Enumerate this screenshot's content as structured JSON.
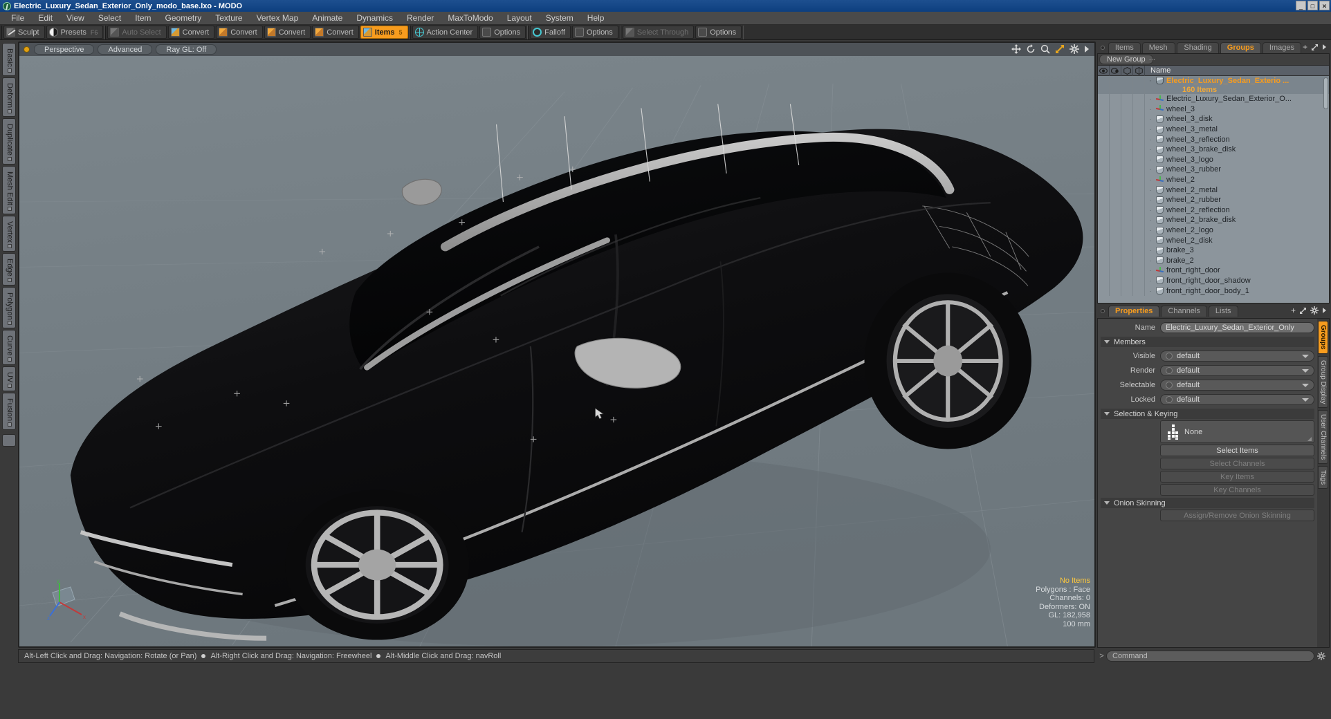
{
  "window": {
    "title": "Electric_Luxury_Sedan_Exterior_Only_modo_base.lxo - MODO",
    "app_icon": "modo-logo-icon",
    "buttons": {
      "minimize": "_",
      "maximize": "□",
      "close": "✕"
    }
  },
  "menubar": {
    "items": [
      "File",
      "Edit",
      "View",
      "Select",
      "Item",
      "Geometry",
      "Texture",
      "Vertex Map",
      "Animate",
      "Dynamics",
      "Render",
      "MaxToModo",
      "Layout",
      "System",
      "Help"
    ]
  },
  "toolbar": {
    "groups": [
      {
        "buttons": [
          {
            "label": "Sculpt",
            "icon": "brush-icon",
            "shortcut": "",
            "state": "normal"
          },
          {
            "label": "Presets",
            "icon": "preset-sphere-icon",
            "shortcut": "F6",
            "state": "normal"
          }
        ]
      },
      {
        "buttons": [
          {
            "label": "Auto Select",
            "icon": "cube-grey-icon",
            "shortcut": "",
            "state": "dim"
          },
          {
            "label": "Convert",
            "icon": "cube-blue-icon",
            "shortcut": "",
            "state": "normal"
          },
          {
            "label": "Convert",
            "icon": "cube-orange-icon",
            "shortcut": "",
            "state": "normal"
          },
          {
            "label": "Convert",
            "icon": "cube-orange-icon",
            "shortcut": "",
            "state": "normal"
          },
          {
            "label": "Convert",
            "icon": "cube-orange-icon",
            "shortcut": "",
            "state": "normal"
          },
          {
            "label": "Items",
            "icon": "cube-blue-icon",
            "shortcut": "5",
            "state": "active"
          }
        ]
      },
      {
        "buttons": [
          {
            "label": "Action Center",
            "icon": "globe-icon",
            "shortcut": "",
            "state": "normal"
          },
          {
            "label": "Options",
            "icon": "square-icon",
            "shortcut": "",
            "state": "normal"
          }
        ]
      },
      {
        "buttons": [
          {
            "label": "Falloff",
            "icon": "ring-icon",
            "shortcut": "",
            "state": "normal"
          },
          {
            "label": "Options",
            "icon": "square-icon",
            "shortcut": "",
            "state": "normal"
          }
        ]
      },
      {
        "buttons": [
          {
            "label": "Select Through",
            "icon": "cube-grey-icon",
            "shortcut": "",
            "state": "dim"
          },
          {
            "label": "Options",
            "icon": "square-icon",
            "shortcut": "",
            "state": "normal"
          }
        ]
      }
    ]
  },
  "left_tabs": {
    "items": [
      "Basic",
      "Deform",
      "Duplicate",
      "Mesh Edit",
      "Vertex",
      "Edge",
      "Polygon",
      "Curve",
      "UV",
      "Fusion"
    ]
  },
  "viewport": {
    "header": {
      "mode": "Perspective",
      "shading": "Advanced",
      "raygl": "Ray GL: Off"
    },
    "icons": [
      "move-icon",
      "rotate-icon",
      "zoom-icon",
      "fit-icon",
      "gear-icon",
      "chevron-right-icon"
    ],
    "stats": {
      "selection": "No Items",
      "polygons": "Polygons : Face",
      "channels": "Channels: 0",
      "deformers": "Deformers: ON",
      "gl": "GL: 182,958",
      "grid": "100 mm"
    },
    "gizmo": {
      "x": "x",
      "y": "y",
      "z": "z"
    }
  },
  "statusbar": {
    "hints": [
      "Alt-Left Click and Drag: Navigation: Rotate (or Pan)",
      "Alt-Right Click and Drag: Navigation: Freewheel",
      "Alt-Middle Click and Drag: navRoll"
    ]
  },
  "right_panel": {
    "tabs": [
      {
        "label": "Items",
        "active": false
      },
      {
        "label": "Mesh ...",
        "active": false
      },
      {
        "label": "Shading",
        "active": false
      },
      {
        "label": "Groups",
        "active": true
      },
      {
        "label": "Images",
        "active": false
      }
    ],
    "tab_add": "+",
    "new_group_button": "New Group",
    "tree_header": {
      "columns": [
        "eye-icon",
        "render-icon",
        "wireframe-icon",
        "ghost-icon"
      ],
      "name": "Name"
    },
    "group": {
      "name": "Electric_Luxury_Sedan_Exterio ...",
      "count": "160 Items"
    },
    "items": [
      {
        "label": "Electric_Luxury_Sedan_Exterior_O...",
        "icon": "locator-icon"
      },
      {
        "label": "wheel_3",
        "icon": "locator-icon"
      },
      {
        "label": "wheel_3_disk",
        "icon": "mesh-icon"
      },
      {
        "label": "wheel_3_metal",
        "icon": "mesh-icon"
      },
      {
        "label": "wheel_3_reflection",
        "icon": "mesh-icon"
      },
      {
        "label": "wheel_3_brake_disk",
        "icon": "mesh-icon"
      },
      {
        "label": "wheel_3_logo",
        "icon": "mesh-icon"
      },
      {
        "label": "wheel_3_rubber",
        "icon": "mesh-icon"
      },
      {
        "label": "wheel_2",
        "icon": "locator-icon"
      },
      {
        "label": "wheel_2_metal",
        "icon": "mesh-icon"
      },
      {
        "label": "wheel_2_rubber",
        "icon": "mesh-icon"
      },
      {
        "label": "wheel_2_reflection",
        "icon": "mesh-icon"
      },
      {
        "label": "wheel_2_brake_disk",
        "icon": "mesh-icon"
      },
      {
        "label": "wheel_2_logo",
        "icon": "mesh-icon"
      },
      {
        "label": "wheel_2_disk",
        "icon": "mesh-icon"
      },
      {
        "label": "brake_3",
        "icon": "mesh-icon"
      },
      {
        "label": "brake_2",
        "icon": "mesh-icon"
      },
      {
        "label": "front_right_door",
        "icon": "locator-icon"
      },
      {
        "label": "front_right_door_shadow",
        "icon": "mesh-icon"
      },
      {
        "label": "front_right_door_body_1",
        "icon": "mesh-icon"
      }
    ]
  },
  "properties": {
    "tabs": [
      {
        "label": "Properties",
        "active": true
      },
      {
        "label": "Channels",
        "active": false
      },
      {
        "label": "Lists",
        "active": false
      }
    ],
    "tab_add": "+",
    "name_label": "Name",
    "name_value": "Electric_Luxury_Sedan_Exterior_Only",
    "sections": [
      {
        "title": "Members",
        "rows": [
          {
            "label": "Visible",
            "value": "default"
          },
          {
            "label": "Render",
            "value": "default"
          },
          {
            "label": "Selectable",
            "value": "default"
          },
          {
            "label": "Locked",
            "value": "default"
          }
        ]
      },
      {
        "title": "Selection & Keying",
        "picker_value": "None",
        "buttons": [
          {
            "label": "Select Items",
            "disabled": false
          },
          {
            "label": "Select Channels",
            "disabled": true
          },
          {
            "label": "Key Items",
            "disabled": true
          },
          {
            "label": "Key Channels",
            "disabled": true
          }
        ]
      },
      {
        "title": "Onion Skinning",
        "buttons": [
          {
            "label": "Assign/Remove Onion Skinning",
            "disabled": true
          }
        ]
      }
    ],
    "side_tabs": [
      {
        "label": "Groups",
        "active": true
      },
      {
        "label": "Group Display",
        "active": false
      },
      {
        "label": "User Channels",
        "active": false
      },
      {
        "label": "Tags",
        "active": false
      }
    ]
  },
  "command_bar": {
    "prompt": ">",
    "placeholder": "Command",
    "value": "Command"
  },
  "colors": {
    "accent": "#f79c1e",
    "panel_bg": "#3a3a3a",
    "tree_bg": "#8c959c",
    "viewport_bg": "#757f85",
    "title_bar": "#1d4f8f"
  }
}
